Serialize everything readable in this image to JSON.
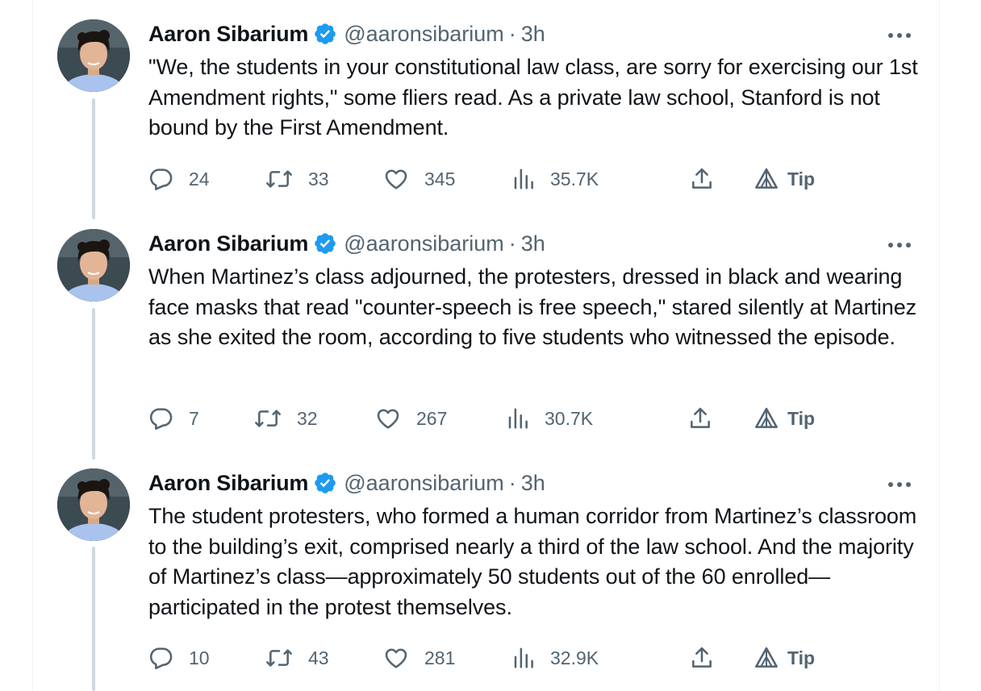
{
  "tweets": [
    {
      "author": {
        "name": "Aaron Sibarium",
        "handle": "@aaronsibarium",
        "time": "3h",
        "verified": true
      },
      "text": "\"We, the students in your constitutional law class, are sorry for exercising our 1st Amendment rights,\" some fliers read. As a private law school, Stanford is not bound by the First Amendment.",
      "stats": {
        "replies": "24",
        "reposts": "33",
        "likes": "345",
        "views": "35.7K",
        "tip": "Tip"
      }
    },
    {
      "author": {
        "name": "Aaron Sibarium",
        "handle": "@aaronsibarium",
        "time": "3h",
        "verified": true
      },
      "text": "When Martinez’s class adjourned, the protesters, dressed in black and wearing face masks that read \"counter-speech is free speech,\" stared silently at Martinez as she exited the room, according to five students who witnessed the episode.",
      "stats": {
        "replies": "7",
        "reposts": "32",
        "likes": "267",
        "views": "30.7K",
        "tip": "Tip"
      }
    },
    {
      "author": {
        "name": "Aaron Sibarium",
        "handle": "@aaronsibarium",
        "time": "3h",
        "verified": true
      },
      "text": "The student protesters, who formed a human corridor from Martinez’s classroom to the building’s exit, comprised nearly a third of the law school. And the majority of Martinez’s class—approximately 50 students out of the 60 enrolled—participated in the protest themselves.",
      "stats": {
        "replies": "10",
        "reposts": "43",
        "likes": "281",
        "views": "32.9K",
        "tip": "Tip"
      }
    }
  ],
  "separator": "·",
  "colors": {
    "text": "#0f1419",
    "secondary": "#536471",
    "verified": "#1d9bf0",
    "thread_line": "#cfd9de",
    "avatar_shirt": "#a9c3ee"
  },
  "icons": {
    "more": "more-dots-icon",
    "reply": "reply-bubble-icon",
    "repost": "repost-arrows-icon",
    "like": "heart-icon",
    "views": "views-bars-icon",
    "share": "share-upload-icon",
    "tip": "tip-triangle-icon",
    "verified": "verified-badge-icon"
  }
}
